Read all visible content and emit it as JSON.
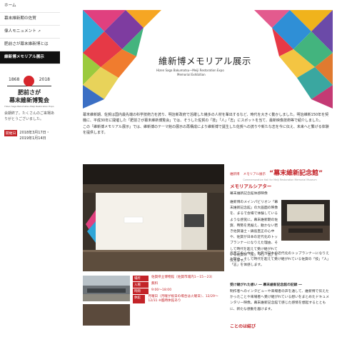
{
  "sidebar": {
    "items": [
      {
        "label": "ホーム"
      },
      {
        "label": "幕末維新期の佐賀"
      },
      {
        "label": "偉人モニュメント",
        "icon": "external-link-icon"
      },
      {
        "label": "肥前さが幕末維新博とは"
      },
      {
        "label": "維新博メモリアル展示"
      }
    ],
    "logo": {
      "year_start": "1868",
      "year_end": "2018",
      "title_line1": "肥前さが",
      "title_line2": "幕末維新博覧会",
      "subtitle": "Hizen Saga Bakumatsu-Meiji Restoration Expo"
    },
    "thanks": "会期終了。たくさんのご来場ありがとうございました。",
    "period_badge": "開催日",
    "period_text": "2018年3月17日・2019年1月14日"
  },
  "hero": {
    "title": "維新博メモリアル展示",
    "subtitle_en1": "Hizen Saga Bakumatsu—Meiji Restoration Expo",
    "subtitle_en2": "Memorial Exhibition"
  },
  "intro": {
    "paragraph": "幕末維新期、佐賀は国内最先端の科学技術力を誇り、明治新政府で活躍した幾多の人材を輩出するなど、時代を大きく動かしました。明治維新150年を契機に、平成30年に開催した「肥前さが幕末維新博覧会」では、そうした佐賀の「技」「人」「志」にスポットを当て、最新映像技術等で紹介しました。",
    "paragraph2": "この「維新博メモリアル展示」では、維新博のテーマ館の展示の再構成により維新博で誕生した佐賀への誇りや新たな志を今に伝え、未来へと繋げる体験を提供します。"
  },
  "photo_sign": "維新博メモリアル展示",
  "info": {
    "rows": [
      {
        "label": "場所",
        "value": "佐賀県立博物館（佐賀市城内1－15－23）"
      },
      {
        "label": "入場",
        "value": "無料"
      },
      {
        "label": "時間",
        "value": "9:00～18:00"
      },
      {
        "label": "休館",
        "value": "月曜日（月曜が祝日の場合は火曜日）、12/29～12/31 ※臨時休館あり"
      }
    ]
  },
  "memorial_hall": {
    "lead": "維新博",
    "lead2": "メモリアル展示",
    "title": "“幕末維新記念館”",
    "sub": "Commemorative Hall for Meiji Restoration Memorial Museum"
  },
  "theater": {
    "heading": "メモリアルシアター",
    "title": "幕末維新記念館体感映像",
    "body": "維新博のメインパビリオン「幕末維新記念館」の大画面の映像を、まるで会場で体験しているような感覚に。幕末維新期の佐賀、時勢を見据え、動かない若き佐賀藩士・鍋島直正の心中や、佐賀が日本の近代化のトップランナーになりえた理由、そして時代を超えて受け継がれている佐賀の「技」「人」「志」を伝えます。",
    "body_cont": "島直正の心中や、佐賀が日本の近代化のトップランナーになりえた理由、そして時代を超えて受け継がれている佐賀の「技」「人」「志」を体感します。"
  },
  "passed": {
    "heading": "受け継がれた想い ― 幕末維新記念館の記録 ―",
    "body": "制作者へのインタビューや来場者の声を通して、維新博で伝えたかったことや来場者へ受け継がれている想いをまとめたドキュメンタリー映像。幕末維新記念館で感じた感情を想起するとともに、新たな感動を届けます。"
  },
  "next_heading": "ことのは結び",
  "colors": {
    "accent": "#c32328",
    "nav_active_bg": "#111111"
  }
}
